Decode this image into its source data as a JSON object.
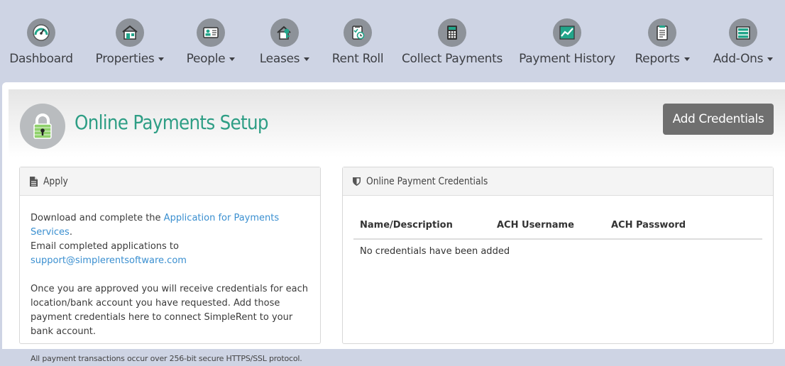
{
  "nav": {
    "items": [
      {
        "label": "Dashboard",
        "icon": "speedometer-icon",
        "dropdown": false
      },
      {
        "label": "Properties",
        "icon": "house-icon",
        "dropdown": true
      },
      {
        "label": "People",
        "icon": "id-card-icon",
        "dropdown": true
      },
      {
        "label": "Leases",
        "icon": "house-key-icon",
        "dropdown": true
      },
      {
        "label": "Rent Roll",
        "icon": "clipboard-clock-icon",
        "dropdown": false
      },
      {
        "label": "Collect Payments",
        "icon": "calculator-icon",
        "dropdown": false
      },
      {
        "label": "Payment History",
        "icon": "chart-icon",
        "dropdown": false
      },
      {
        "label": "Reports",
        "icon": "report-icon",
        "dropdown": true
      },
      {
        "label": "Add-Ons",
        "icon": "cabinet-icon",
        "dropdown": true
      }
    ]
  },
  "page": {
    "title": "Online Payments Setup",
    "add_button": "Add Credentials"
  },
  "apply": {
    "heading": "Apply",
    "line1_prefix": "Download and complete the ",
    "line1_link": "Application for Payments Services",
    "line1_suffix": ".",
    "line2_prefix": "Email completed applications to ",
    "line2_link": "support@simplerentsoftware.com",
    "para2": "Once you are approved you will receive credentials for each location/bank account you have requested. Add those payment credentials here to connect SimpleRent to your bank account.",
    "note": "All payment transactions occur over 256-bit secure HTTPS/SSL protocol."
  },
  "credentials": {
    "heading": "Online Payment Credentials",
    "columns": [
      "Name/Description",
      "ACH Username",
      "ACH Password"
    ],
    "empty_text": "No credentials have been added"
  },
  "colors": {
    "nav_bg": "#ced4e4",
    "icon_bg": "#8d9299",
    "icon_accent": "#22a58a",
    "title": "#2e9e85",
    "button_bg": "#6f6f6f",
    "link": "#3a8fd0"
  }
}
